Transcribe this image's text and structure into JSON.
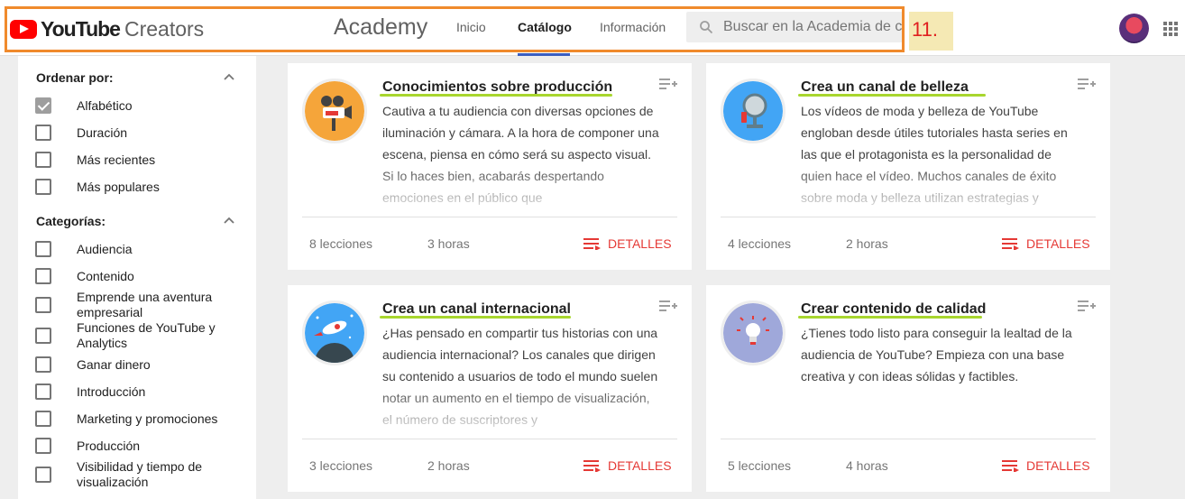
{
  "header": {
    "logo_youtube": "YouTube",
    "logo_creators": "Creators",
    "academy": "Academy",
    "tabs": [
      {
        "label": "Inicio",
        "active": false
      },
      {
        "label": "Catálogo",
        "active": true
      },
      {
        "label": "Información",
        "active": false
      }
    ],
    "search_placeholder": "Buscar en la Academia de c",
    "step_label": "11."
  },
  "sidebar": {
    "sort": {
      "title": "Ordenar por:",
      "options": [
        {
          "label": "Alfabético",
          "checked": true
        },
        {
          "label": "Duración",
          "checked": false
        },
        {
          "label": "Más recientes",
          "checked": false
        },
        {
          "label": "Más populares",
          "checked": false
        }
      ]
    },
    "categories": {
      "title": "Categorías:",
      "options": [
        {
          "label": "Audiencia"
        },
        {
          "label": "Contenido"
        },
        {
          "label": "Emprende una aventura empresarial"
        },
        {
          "label": "Funciones de YouTube y Analytics"
        },
        {
          "label": "Ganar dinero"
        },
        {
          "label": "Introducción"
        },
        {
          "label": "Marketing y promociones"
        },
        {
          "label": "Producción"
        },
        {
          "label": "Visibilidad y tiempo de visualización"
        }
      ]
    }
  },
  "cards": [
    {
      "title": "Conocimientos sobre producción",
      "description": "Cautiva a tu audiencia con diversas opciones de iluminación y cámara. A la hora de componer una escena, piensa en cómo será su aspecto visual. Si lo haces bien, acabarás despertando emociones en el público que",
      "lessons": "8 lecciones",
      "hours": "3 horas",
      "details": "DETALLES",
      "icon": "camera-icon"
    },
    {
      "title": "Crea un canal de belleza",
      "description": "Los vídeos de moda y belleza de YouTube engloban desde útiles tutoriales hasta series en las que el protagonista es la personalidad de quien hace el vídeo. Muchos canales de éxito sobre moda y belleza utilizan estrategias y",
      "lessons": "4 lecciones",
      "hours": "2 horas",
      "details": "DETALLES",
      "icon": "mirror-icon"
    },
    {
      "title": "Crea un canal internacional",
      "description": "¿Has pensado en compartir tus historias con una audiencia internacional? Los canales que dirigen su contenido a usuarios de todo el mundo suelen notar un aumento en el tiempo de visualización, el número de suscriptores y",
      "lessons": "3 lecciones",
      "hours": "2 horas",
      "details": "DETALLES",
      "icon": "rocket-icon"
    },
    {
      "title": "Crear contenido de calidad",
      "description": "¿Tienes todo listo para conseguir la lealtad de la audiencia de YouTube? Empieza con una base creativa y con ideas sólidas y factibles.",
      "lessons": "5 lecciones",
      "hours": "4 horas",
      "details": "DETALLES",
      "icon": "lightbulb-icon"
    }
  ],
  "colors": {
    "highlight_box": "#f08a2c",
    "title_marker": "#a8d62e",
    "details_red": "#e53935",
    "youtube_red": "#ff0000"
  }
}
